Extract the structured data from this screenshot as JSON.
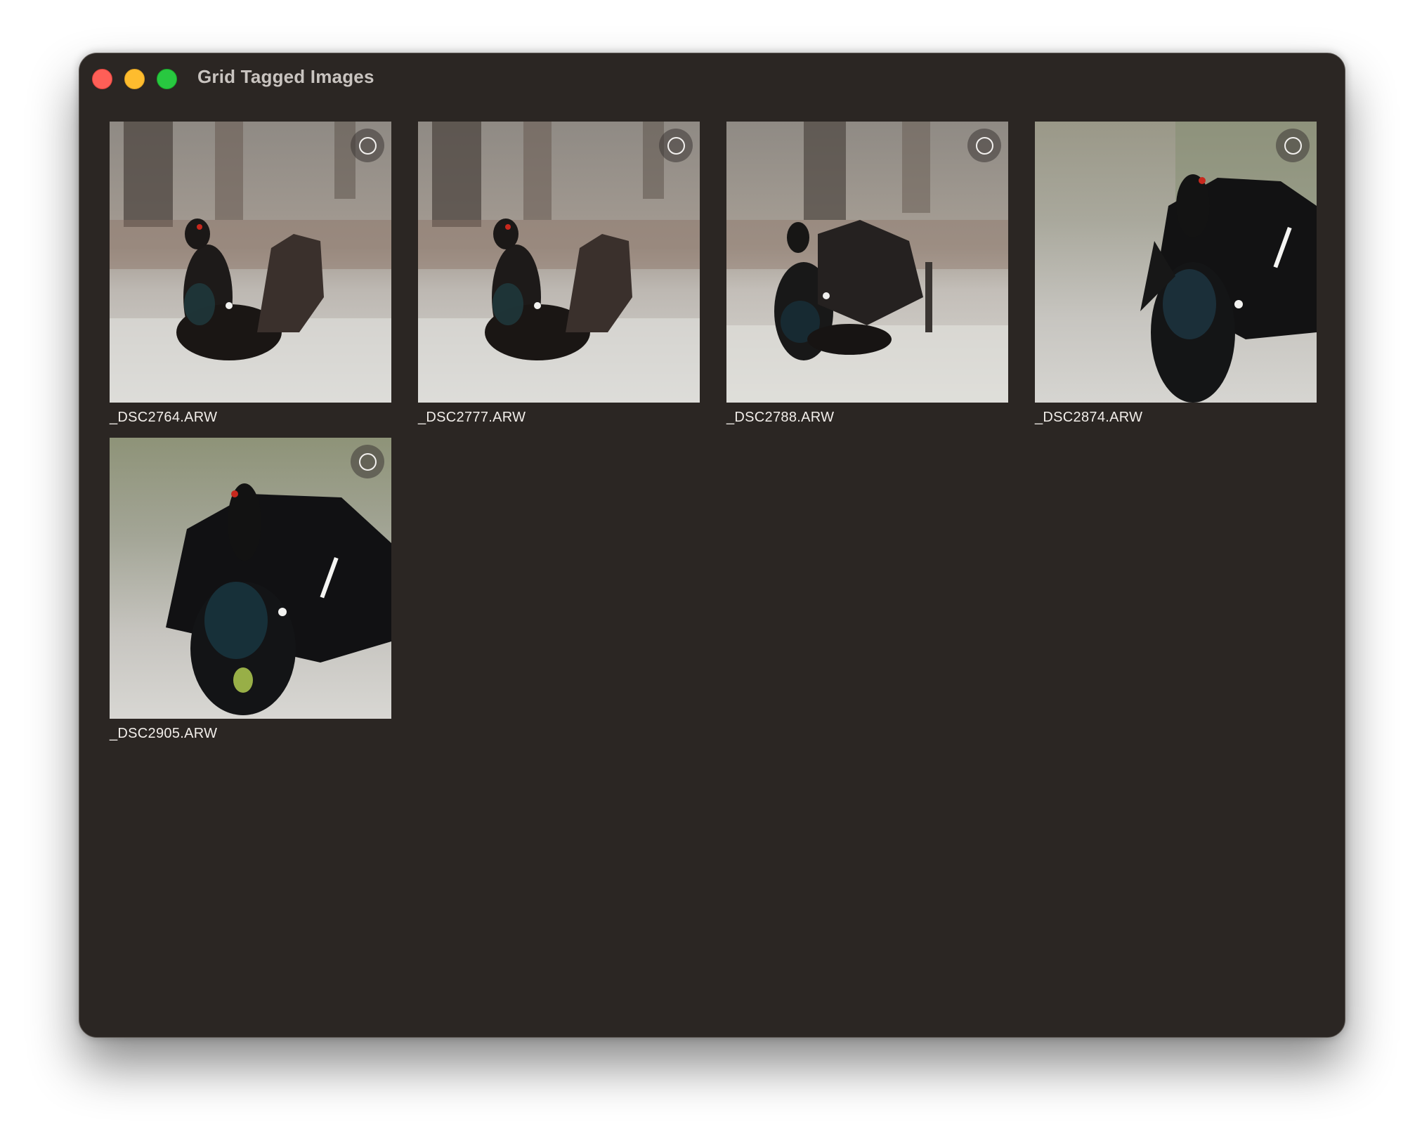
{
  "window": {
    "title": "Grid Tagged Images"
  },
  "images": [
    {
      "filename": "_DSC2764.ARW",
      "selected": false
    },
    {
      "filename": "_DSC2777.ARW",
      "selected": false
    },
    {
      "filename": "_DSC2788.ARW",
      "selected": false
    },
    {
      "filename": "_DSC2874.ARW",
      "selected": false
    },
    {
      "filename": "_DSC2905.ARW",
      "selected": false
    }
  ],
  "icons": {
    "select": "circle-outline-icon"
  },
  "colors": {
    "window_bg": "#2b2623",
    "close": "#fe5f57",
    "minimize": "#febc2e",
    "maximize": "#28c840"
  }
}
